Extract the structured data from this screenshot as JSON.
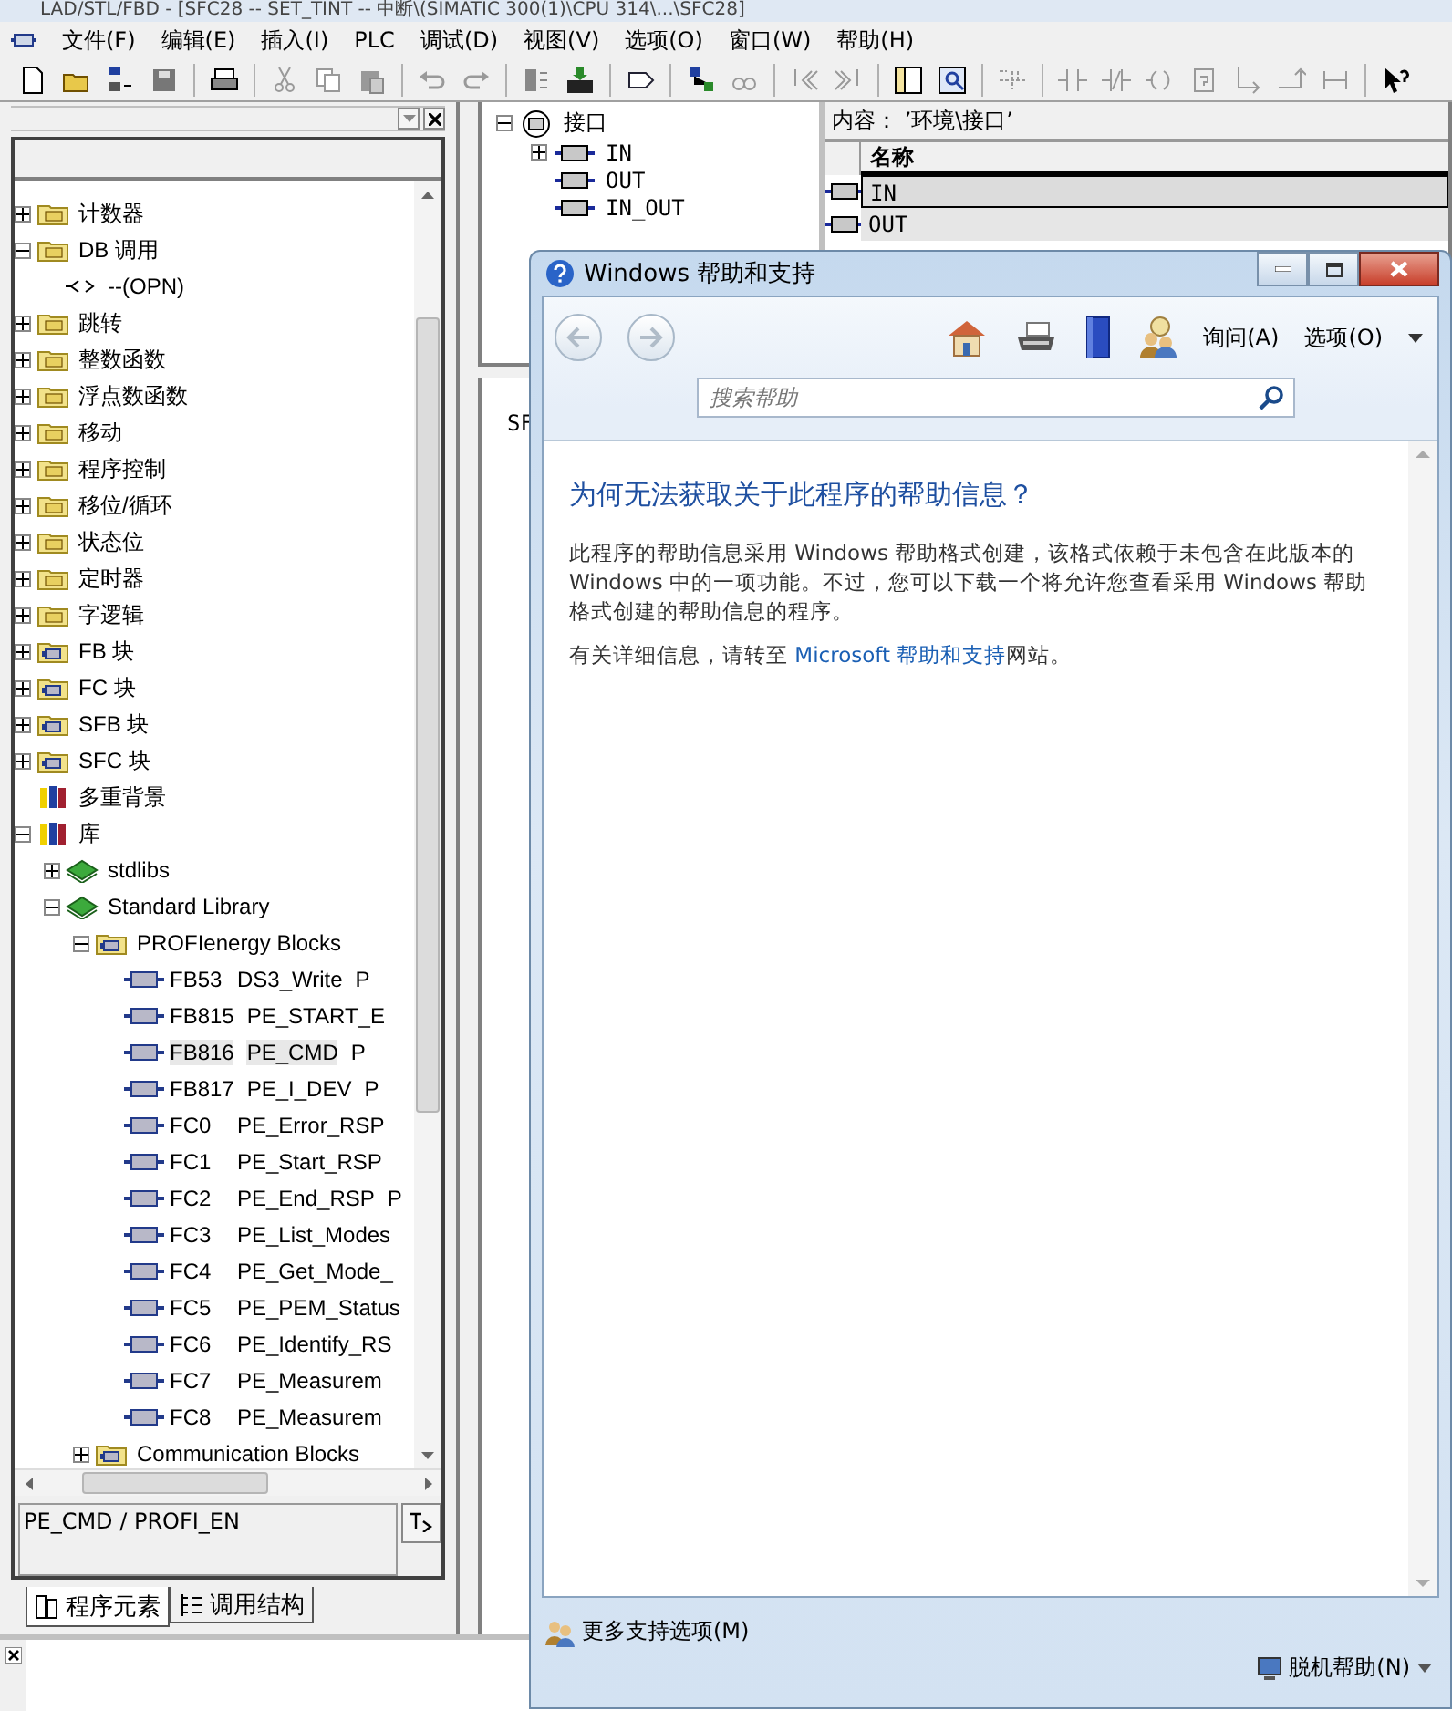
{
  "app": {
    "title": "LAD/STL/FBD - [SFC28 -- SET_TINT -- 中断\\(SIMATIC 300(1)\\CPU 314\\...\\SFC28]",
    "menu": [
      "文件(F)",
      "编辑(E)",
      "插入(I)",
      "PLC",
      "调试(D)",
      "视图(V)",
      "选项(O)",
      "窗口(W)",
      "帮助(H)"
    ]
  },
  "program_elements": {
    "tree": [
      {
        "label": "计数器",
        "kind": "folder",
        "expanded": false,
        "selected": false
      },
      {
        "label": "DB 调用",
        "kind": "folder",
        "expanded": true,
        "selected": false,
        "children": [
          {
            "label": "--(OPN)",
            "kind": "call",
            "selected": false
          }
        ]
      },
      {
        "label": "跳转",
        "kind": "folder",
        "expanded": false,
        "selected": false
      },
      {
        "label": "整数函数",
        "kind": "folder",
        "expanded": false,
        "selected": false
      },
      {
        "label": "浮点数函数",
        "kind": "folder",
        "expanded": false,
        "selected": false
      },
      {
        "label": "移动",
        "kind": "folder",
        "expanded": false,
        "selected": false
      },
      {
        "label": "程序控制",
        "kind": "folder",
        "expanded": false,
        "selected": false
      },
      {
        "label": "移位/循环",
        "kind": "folder",
        "expanded": false,
        "selected": false
      },
      {
        "label": "状态位",
        "kind": "folder",
        "expanded": false,
        "selected": false
      },
      {
        "label": "定时器",
        "kind": "folder",
        "expanded": false,
        "selected": false
      },
      {
        "label": "字逻辑",
        "kind": "folder",
        "expanded": false,
        "selected": false
      },
      {
        "label": "FB 块",
        "kind": "blockfolder",
        "expanded": false,
        "selected": false
      },
      {
        "label": "FC 块",
        "kind": "blockfolder",
        "expanded": false,
        "selected": false
      },
      {
        "label": "SFB 块",
        "kind": "blockfolder",
        "expanded": false,
        "selected": false
      },
      {
        "label": "SFC 块",
        "kind": "blockfolder",
        "expanded": false,
        "selected": false
      },
      {
        "label": "多重背景",
        "kind": "books",
        "selected": false
      },
      {
        "label": "库",
        "kind": "books",
        "expanded": true,
        "selected": false,
        "children": [
          {
            "label": "stdlibs",
            "kind": "library",
            "expanded": false,
            "selected": false
          },
          {
            "label": "Standard Library",
            "kind": "library",
            "expanded": true,
            "selected": false,
            "children": [
              {
                "label": "PROFIenergy Blocks",
                "kind": "blockfolder",
                "expanded": true,
                "selected": false,
                "children": [
                  {
                    "label": "FB53",
                    "name": "DS3_Write",
                    "comment": "P",
                    "kind": "block",
                    "selected": false
                  },
                  {
                    "label": "FB815",
                    "name": "PE_START_E",
                    "kind": "block",
                    "selected": false
                  },
                  {
                    "label": "FB816",
                    "name": "PE_CMD",
                    "comment": "P",
                    "kind": "block",
                    "selected": true
                  },
                  {
                    "label": "FB817",
                    "name": "PE_I_DEV",
                    "comment": "P",
                    "kind": "block",
                    "selected": false
                  },
                  {
                    "label": "FC0",
                    "name": "PE_Error_RSP",
                    "kind": "block",
                    "selected": false
                  },
                  {
                    "label": "FC1",
                    "name": "PE_Start_RSP",
                    "kind": "block",
                    "selected": false
                  },
                  {
                    "label": "FC2",
                    "name": "PE_End_RSP",
                    "comment": "P",
                    "kind": "block",
                    "selected": false
                  },
                  {
                    "label": "FC3",
                    "name": "PE_List_Modes",
                    "kind": "block",
                    "selected": false
                  },
                  {
                    "label": "FC4",
                    "name": "PE_Get_Mode_",
                    "kind": "block",
                    "selected": false
                  },
                  {
                    "label": "FC5",
                    "name": "PE_PEM_Status",
                    "kind": "block",
                    "selected": false
                  },
                  {
                    "label": "FC6",
                    "name": "PE_Identify_RS",
                    "kind": "block",
                    "selected": false
                  },
                  {
                    "label": "FC7",
                    "name": "PE_Measurem",
                    "kind": "block",
                    "selected": false
                  },
                  {
                    "label": "FC8",
                    "name": "PE_Measurem",
                    "kind": "block",
                    "selected": false
                  }
                ]
              },
              {
                "label": "Communication Blocks",
                "kind": "blockfolder",
                "expanded": false,
                "selected": false
              }
            ]
          }
        ]
      }
    ],
    "info": "PE_CMD / PROFI_EN",
    "tabs": [
      {
        "label": "程序元素",
        "selected": true
      },
      {
        "label": "调用结构",
        "selected": false
      }
    ]
  },
  "interface_tree": {
    "label": "接口",
    "expanded": true,
    "children": [
      {
        "label": "IN",
        "expanded": false
      },
      {
        "label": "OUT"
      },
      {
        "label": "IN_OUT"
      }
    ]
  },
  "content_panel": {
    "path": "内容：  ’环境\\接口’",
    "columns": [
      "名称"
    ],
    "rows": [
      {
        "name": "IN",
        "selected": true
      },
      {
        "name": "OUT",
        "selected": false
      }
    ]
  },
  "editor": {
    "text": "SF"
  },
  "help_window": {
    "title": "Windows 帮助和支持",
    "buttons": [
      "询问(A)",
      "选项(O)"
    ],
    "search": {
      "placeholder": "搜索帮助"
    },
    "heading": "为何无法获取关于此程序的帮助信息？",
    "paragraph": "此程序的帮助信息采用 Windows 帮助格式创建，该格式依赖于未包含在此版本的 Windows 中的一项功能。不过，您可以下载一个将允许您查看采用 Windows 帮助格式创建的帮助信息的程序。",
    "link_paragraph": {
      "before": "有关详细信息，请转至 ",
      "link": "Microsoft 帮助和支持",
      "after": "网站。"
    },
    "footer": [
      "更多支持选项(M)",
      "脱机帮助(N)"
    ]
  }
}
